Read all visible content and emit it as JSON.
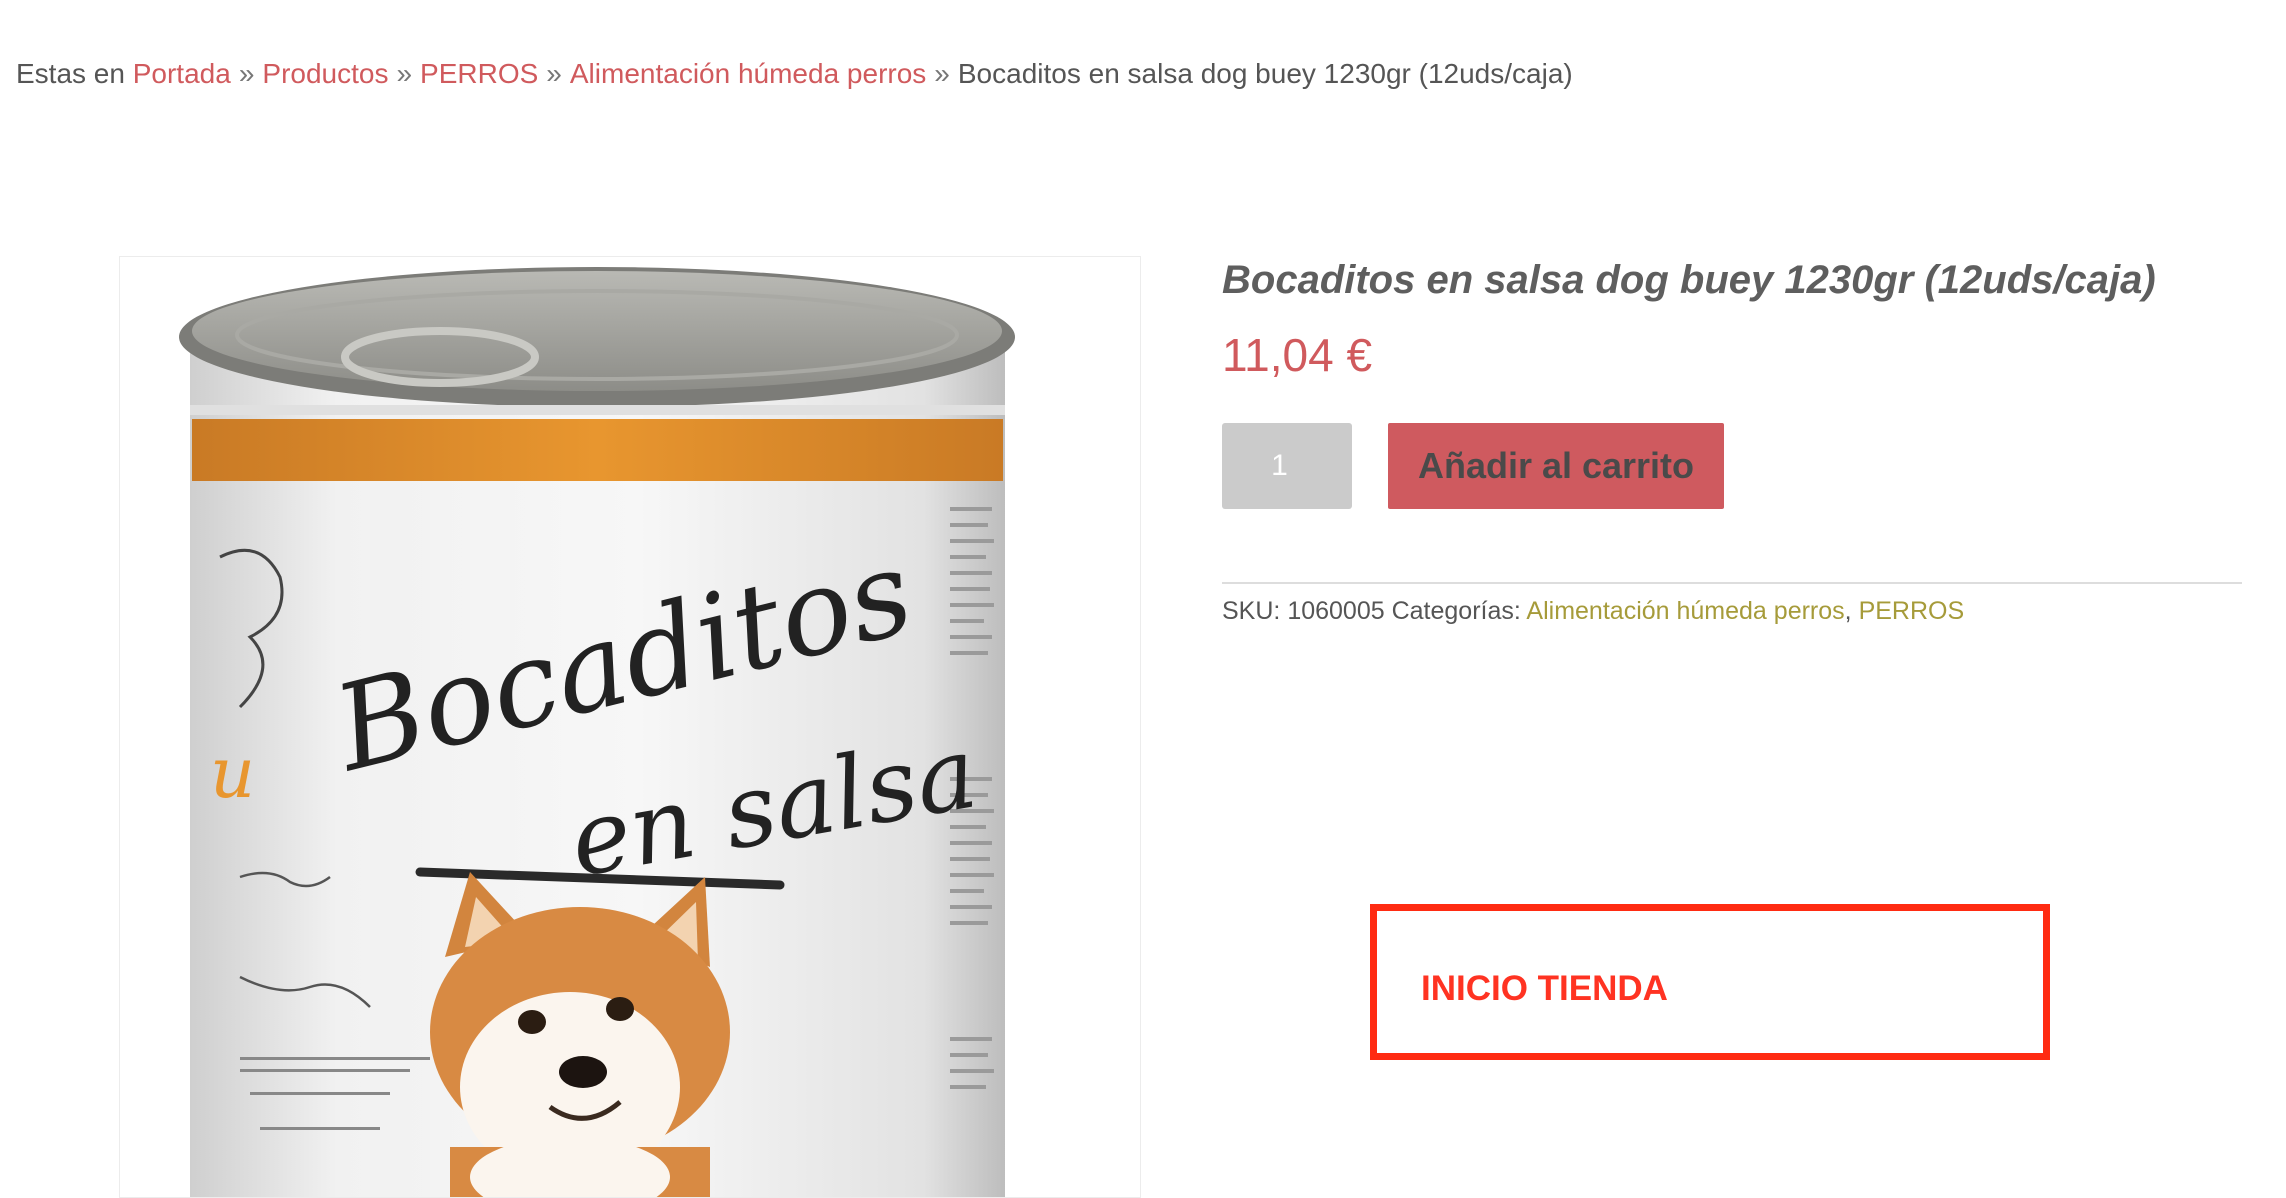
{
  "breadcrumb": {
    "prefix": "Estas en",
    "separator": "»",
    "links": [
      "Portada",
      "Productos",
      "PERROS",
      "Alimentación húmeda perros"
    ],
    "current": "Bocaditos en salsa dog buey 1230gr (12uds/caja)"
  },
  "product": {
    "title": "Bocaditos en salsa dog buey 1230gr (12uds/caja)",
    "price": "11,04 €",
    "quantity": "1",
    "add_to_cart_label": "Añadir al carrito",
    "sku_label": "SKU:",
    "sku_value": "1060005",
    "categories_label": "Categorías:",
    "categories": [
      "Alimentación húmeda perros",
      "PERROS"
    ],
    "category_separator": ","
  },
  "image": {
    "label_line1": "Bocaditos",
    "label_line2": "en salsa"
  },
  "shop_link": {
    "label": "INICIO TIENDA"
  },
  "colors": {
    "accent": "#d05a5d",
    "category_link": "#a69b3a",
    "highlight_border": "#ff2b12",
    "can_band": "#e3932e"
  }
}
